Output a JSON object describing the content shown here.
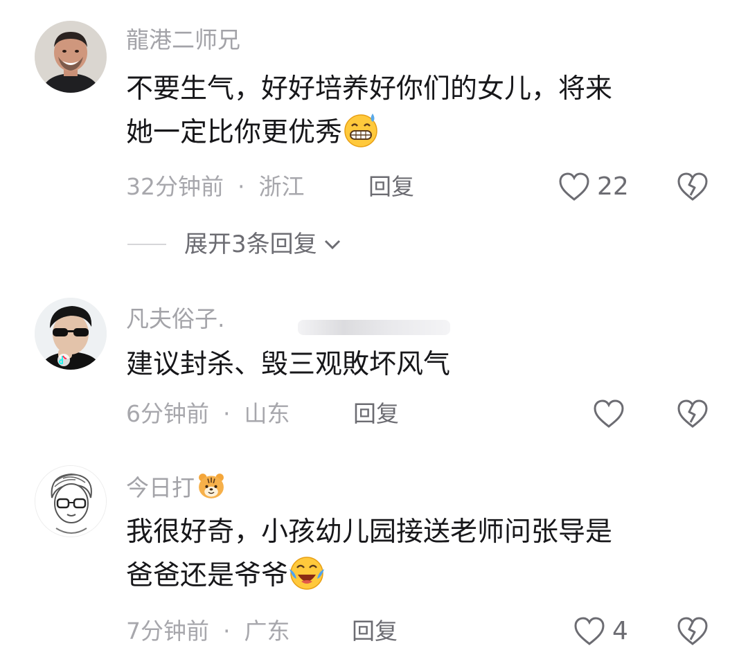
{
  "comments": [
    {
      "username": "龍港二师兄",
      "text_lines": [
        "不要生气，好好培养好你们的女儿，将来",
        "她一定比你更优秀"
      ],
      "emoji": "grinning-sweat-emoji",
      "time": "32分钟前",
      "separator": "·",
      "region": "浙江",
      "reply_label": "回复",
      "like_count": "22",
      "expand_replies_label": "展开3条回复"
    },
    {
      "username": "凡夫俗子.",
      "text_lines": [
        "建议封杀、毁三观敗坏风气"
      ],
      "time": "6分钟前",
      "separator": "·",
      "region": "山东",
      "reply_label": "回复",
      "like_count": ""
    },
    {
      "username": "今日打",
      "username_emoji": "tiger-face-emoji",
      "text_lines": [
        "我很好奇，小孩幼儿园接送老师问张导是",
        "爸爸还是爷爷"
      ],
      "emoji": "laughing-crying-emoji",
      "time": "7分钟前",
      "separator": "·",
      "region": "广东",
      "reply_label": "回复",
      "like_count": "4"
    }
  ],
  "icons": {
    "like": "heart-outline-icon",
    "dislike": "broken-heart-icon",
    "expand": "chevron-down-icon"
  },
  "colors": {
    "username": "#a3a3a8",
    "text": "#17171a",
    "meta": "#a7a7ac",
    "action": "#6c6c72"
  }
}
